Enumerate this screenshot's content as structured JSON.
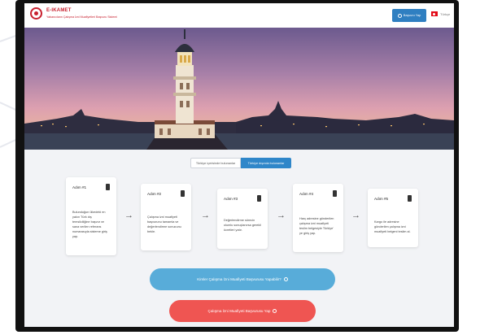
{
  "header": {
    "brand_title": "E-IKAMET",
    "brand_subtitle": "Yabancıların Çalışma İzni Muafiyetleri Başvuru Sistemi",
    "apply_button": "Başvuru Yap",
    "language": "Türkçe"
  },
  "tabs": [
    {
      "label": "Türkiye içerisinde bulunanlar",
      "active": false
    },
    {
      "label": "Türkiye dışında bulunanlar",
      "active": true
    }
  ],
  "steps": [
    {
      "title": "Adım #1",
      "text": "Bulunduğun ülkedeki en yakın Türk dış temsilciliğine başvur ve sana verilen referans numarasıyla sisteme giriş yap."
    },
    {
      "title": "Adım #2",
      "text": "Çalışma izni muafiyeti başvurunu tamamla ve değerlendirme sonucunu bekle."
    },
    {
      "title": "Adım #3",
      "text": "Değerlendirme sürecin olumlu sonuçlanırsa gerekli ücretleri yatır."
    },
    {
      "title": "Adım #4",
      "text": "Harç adresine gönderilen çalışma izni muafiyeti teslim belgesiyle Türkiye' ye giriş yap."
    },
    {
      "title": "Adım #5",
      "text": "Kargo ile adresine gönderilen çalışma izni muafiyeti belgeni teslim al."
    }
  ],
  "cta": {
    "who_can_apply": "Kimler Çalışma İzni Muafiyeti Başvurusu Yapabilir?",
    "apply": "Çalışma İzni Muafiyeti Başvurusu Yap"
  },
  "colors": {
    "brand_red": "#c8202f",
    "primary_blue": "#2f86c9",
    "cta_blue": "#58acd9",
    "cta_red": "#ef5552"
  }
}
